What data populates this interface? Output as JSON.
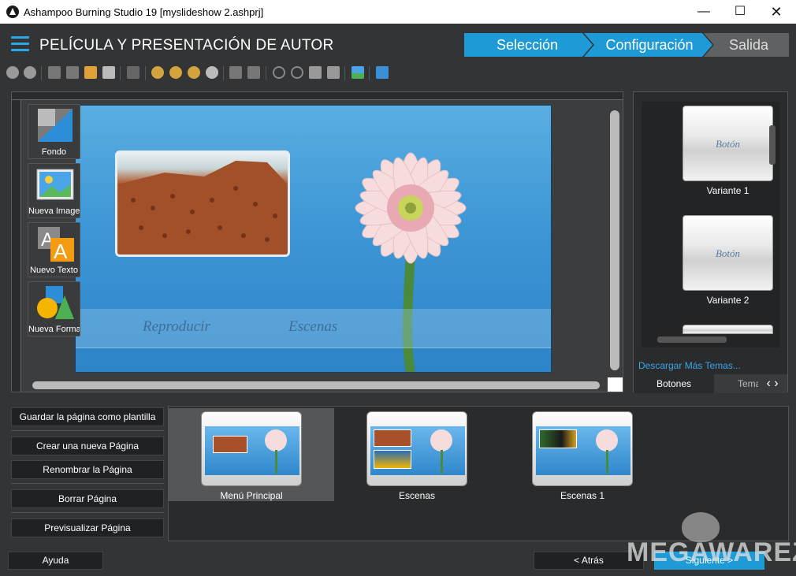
{
  "window": {
    "title": "Ashampoo Burning Studio 19 [myslideshow 2.ashprj]"
  },
  "header": {
    "title": "PELÍCULA Y PRESENTACIÓN DE AUTOR",
    "steps": [
      {
        "label": "Selección",
        "state": "done"
      },
      {
        "label": "Configuración",
        "state": "active"
      },
      {
        "label": "Salida",
        "state": "pending"
      }
    ]
  },
  "toolbar": {
    "icons": [
      "back-icon",
      "forward-icon",
      "cut-icon",
      "delete-icon",
      "paste-icon",
      "copy-icon",
      "remove-icon",
      "zoom-fit-icon",
      "zoom-in-icon",
      "zoom-out-icon",
      "zoom-reset-icon",
      "bring-front-icon",
      "send-back-icon",
      "rotate-left-icon",
      "rotate-right-icon",
      "flip-h-icon",
      "flip-v-icon",
      "insert-image-icon",
      "layers-icon"
    ]
  },
  "tools": [
    {
      "label": "Fondo",
      "icon": "background-icon"
    },
    {
      "label": "Nueva Imagen",
      "icon": "image-icon"
    },
    {
      "label": "Nuevo Texto",
      "icon": "text-icon"
    },
    {
      "label": "Nueva Forma",
      "icon": "shape-icon"
    }
  ],
  "slide": {
    "button1": "Reproducir",
    "button2": "Escenas"
  },
  "themes": {
    "variants": [
      {
        "label": "Variante 1",
        "button_text": "Botón"
      },
      {
        "label": "Variante 2",
        "button_text": "Botón"
      }
    ],
    "download_link": "Descargar Más Temas...",
    "tab_buttons": "Botones",
    "tab_themes": "Temas"
  },
  "page_actions": [
    "Guardar la página como plantilla",
    "Crear una nueva Página",
    "Renombrar la Página",
    "Borrar Página",
    "Previsualizar Página"
  ],
  "pages": [
    {
      "label": "Menú Principal",
      "selected": true
    },
    {
      "label": "Escenas",
      "selected": false
    },
    {
      "label": "Escenas 1",
      "selected": false
    }
  ],
  "footer": {
    "help": "Ayuda",
    "back": "< Atrás",
    "next": "Siguiente >"
  },
  "watermark": "MEGAWAREZ",
  "colors": {
    "accent": "#2aa7e6",
    "step_active": "#1e9ad6"
  }
}
